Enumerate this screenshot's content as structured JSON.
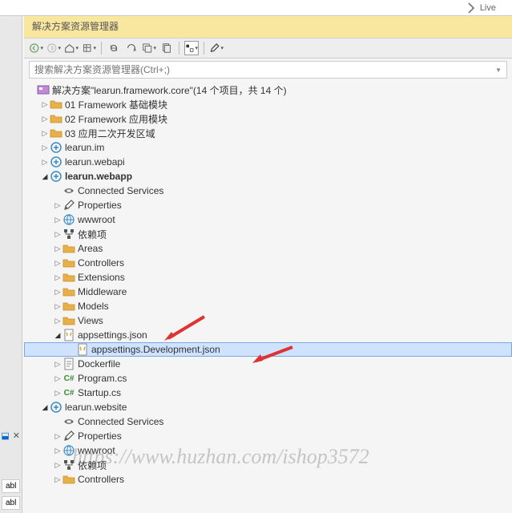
{
  "topBar": {
    "liveShare": "Live"
  },
  "panel": {
    "title": "解决方案资源管理器"
  },
  "search": {
    "placeholder": "搜索解决方案资源管理器(Ctrl+;)"
  },
  "solution": {
    "label": "解决方案\"learun.framework.core\"(14 个项目，共 14 个)"
  },
  "root": [
    {
      "type": "folder",
      "label": "01 Framework 基础模块",
      "expanded": false
    },
    {
      "type": "folder",
      "label": "02 Framework 应用模块",
      "expanded": false
    },
    {
      "type": "folder",
      "label": "03 应用二次开发区域",
      "expanded": false
    },
    {
      "type": "project",
      "label": "learun.im",
      "expanded": false
    },
    {
      "type": "project",
      "label": "learun.webapi",
      "expanded": false
    },
    {
      "type": "project",
      "label": "learun.webapp",
      "expanded": true,
      "bold": true,
      "children": [
        {
          "type": "connected",
          "label": "Connected Services"
        },
        {
          "type": "props",
          "label": "Properties",
          "expandable": true
        },
        {
          "type": "web",
          "label": "wwwroot",
          "expandable": true
        },
        {
          "type": "deps",
          "label": "依赖项",
          "expandable": true
        },
        {
          "type": "folder",
          "label": "Areas",
          "expandable": true
        },
        {
          "type": "folder",
          "label": "Controllers",
          "expandable": true
        },
        {
          "type": "folder",
          "label": "Extensions",
          "expandable": true
        },
        {
          "type": "folder",
          "label": "Middleware",
          "expandable": true
        },
        {
          "type": "folder",
          "label": "Models",
          "expandable": true
        },
        {
          "type": "folder",
          "label": "Views",
          "expandable": true
        },
        {
          "type": "json",
          "label": "appsettings.json",
          "expanded": true,
          "children": [
            {
              "type": "json",
              "label": "appsettings.Development.json",
              "selected": true
            }
          ]
        },
        {
          "type": "file",
          "label": "Dockerfile",
          "expandable": true
        },
        {
          "type": "cs",
          "label": "Program.cs",
          "expandable": true
        },
        {
          "type": "cs",
          "label": "Startup.cs",
          "expandable": true
        }
      ]
    },
    {
      "type": "project",
      "label": "learun.website",
      "expanded": true,
      "children": [
        {
          "type": "connected",
          "label": "Connected Services"
        },
        {
          "type": "props",
          "label": "Properties",
          "expandable": true
        },
        {
          "type": "web",
          "label": "wwwroot",
          "expandable": true
        },
        {
          "type": "deps",
          "label": "依赖项",
          "expandable": true
        },
        {
          "type": "folder",
          "label": "Controllers",
          "expandable": true
        }
      ]
    }
  ],
  "leftTabs": [
    "abl",
    "abl"
  ],
  "watermark": "https://www.huzhan.com/ishop3572"
}
